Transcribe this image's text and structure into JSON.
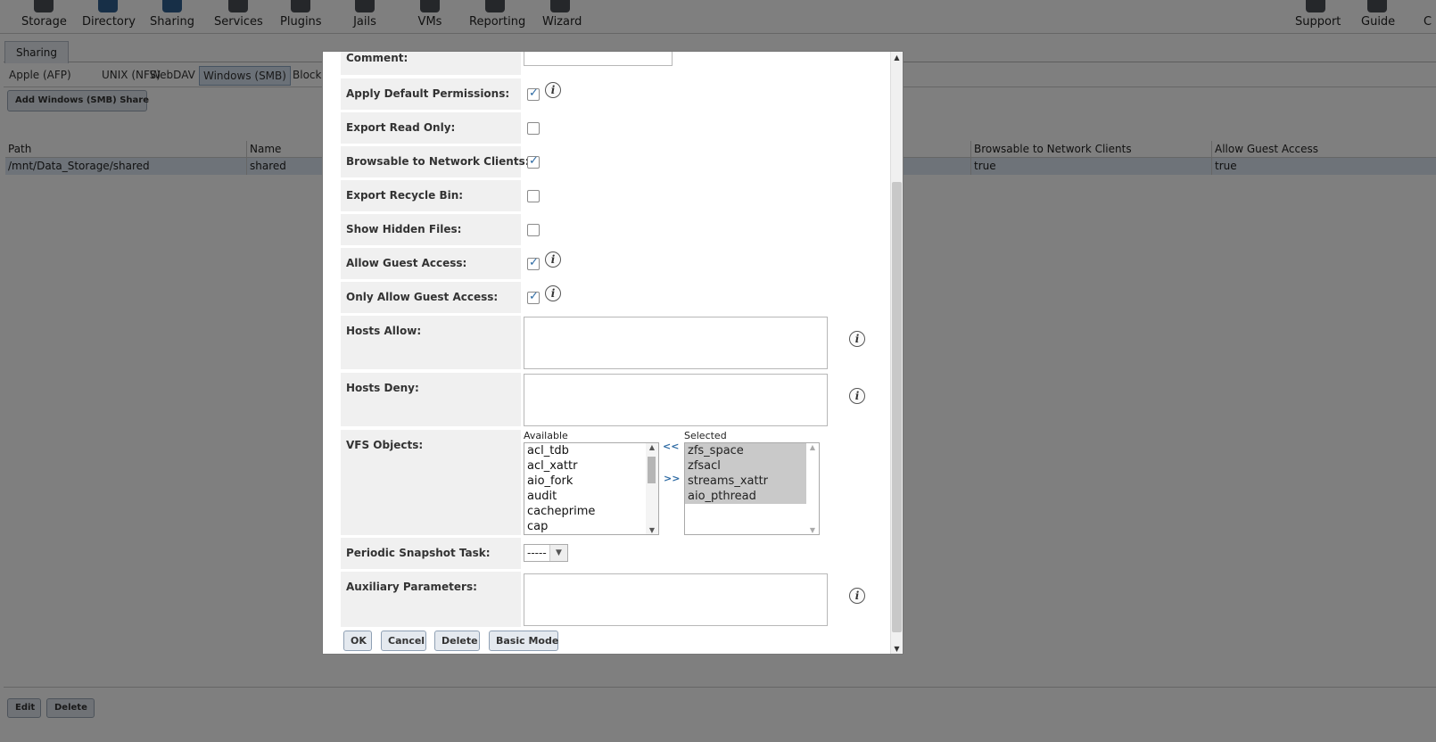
{
  "nav": {
    "items": [
      {
        "label": "Storage",
        "icon": "storage-icon"
      },
      {
        "label": "Directory",
        "icon": "directory-icon"
      },
      {
        "label": "Sharing",
        "icon": "sharing-icon"
      },
      {
        "label": "Services",
        "icon": "services-icon"
      },
      {
        "label": "Plugins",
        "icon": "plugins-icon"
      },
      {
        "label": "Jails",
        "icon": "jails-icon"
      },
      {
        "label": "VMs",
        "icon": "vms-icon"
      },
      {
        "label": "Reporting",
        "icon": "reporting-icon"
      },
      {
        "label": "Wizard",
        "icon": "wizard-icon"
      }
    ],
    "right": [
      {
        "label": "Support",
        "icon": "support-icon"
      },
      {
        "label": "Guide",
        "icon": "guide-icon"
      },
      {
        "label": "C",
        "icon": "console-icon"
      }
    ]
  },
  "page": {
    "main_tab": "Sharing",
    "subtabs": [
      "Apple (AFP)",
      "UNIX (NFS)",
      "WebDAV",
      "Windows (SMB)",
      "Block ("
    ],
    "add_button": "Add Windows (SMB) Share",
    "table": {
      "headers": [
        "Path",
        "Name",
        "Browsable to Network Clients",
        "Allow Guest Access"
      ],
      "rows": [
        [
          "/mnt/Data_Storage/shared",
          "shared",
          "true",
          "true"
        ]
      ]
    },
    "edit_button": "Edit",
    "delete_button": "Delete"
  },
  "modal": {
    "fields": {
      "comment": {
        "label": "Comment:",
        "value": ""
      },
      "apply_default_permissions": {
        "label": "Apply Default Permissions:",
        "checked": true
      },
      "export_read_only": {
        "label": "Export Read Only:",
        "checked": false
      },
      "browsable": {
        "label": "Browsable to Network Clients:",
        "checked": true
      },
      "export_recycle_bin": {
        "label": "Export Recycle Bin:",
        "checked": false
      },
      "show_hidden_files": {
        "label": "Show Hidden Files:",
        "checked": false
      },
      "allow_guest_access": {
        "label": "Allow Guest Access:",
        "checked": true
      },
      "only_allow_guest_access": {
        "label": "Only Allow Guest Access:",
        "checked": true
      },
      "hosts_allow": {
        "label": "Hosts Allow:",
        "value": ""
      },
      "hosts_deny": {
        "label": "Hosts Deny:",
        "value": ""
      },
      "vfs_objects": {
        "label": "VFS Objects:",
        "available_caption": "Available",
        "selected_caption": "Selected",
        "available": [
          "acl_tdb",
          "acl_xattr",
          "aio_fork",
          "audit",
          "cacheprime",
          "cap"
        ],
        "selected": [
          "zfs_space",
          "zfsacl",
          "streams_xattr",
          "aio_pthread"
        ],
        "move_left": "<<",
        "move_right": ">>"
      },
      "periodic_snapshot_task": {
        "label": "Periodic Snapshot Task:",
        "value": "-----"
      },
      "auxiliary_parameters": {
        "label": "Auxiliary Parameters:",
        "value": ""
      }
    },
    "buttons": {
      "ok": "OK",
      "cancel": "Cancel",
      "delete": "Delete",
      "basic_mode": "Basic Mode"
    },
    "info_glyph": "i"
  }
}
